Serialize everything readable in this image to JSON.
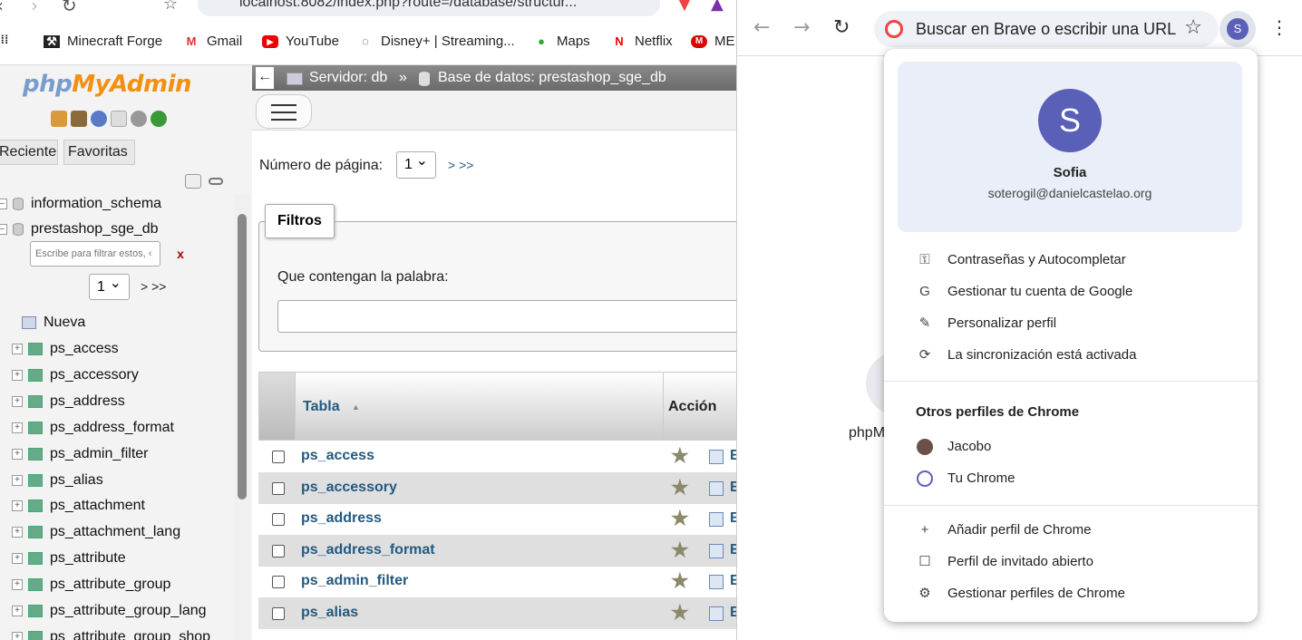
{
  "left_browser": {
    "url": "localhost:8082/index.php?route=/database/structur...",
    "bookmarks": [
      "Minecraft Forge",
      "Gmail",
      "YouTube",
      "Disney+ | Streaming...",
      "Maps",
      "Netflix",
      "ME"
    ]
  },
  "pma": {
    "logo_php": "php",
    "logo_myadmin": "MyAdmin",
    "tabs": [
      "Reciente",
      "Favoritas"
    ],
    "databases": [
      "information_schema",
      "prestashop_sge_db"
    ],
    "filter_placeholder": "Escribe para filtrar estos, ‹",
    "filter_clear": "x",
    "page_select": "1",
    "page_nav": "> >>",
    "new_label": "Nueva",
    "tables": [
      "ps_access",
      "ps_accessory",
      "ps_address",
      "ps_address_format",
      "ps_admin_filter",
      "ps_alias",
      "ps_attachment",
      "ps_attachment_lang",
      "ps_attribute",
      "ps_attribute_group",
      "ps_attribute_group_lang",
      "ps_attribute_group_shop"
    ],
    "breadcrumb": {
      "back": "←",
      "server": "Servidor: db",
      "sep": "»",
      "database": "Base de datos: prestashop_sge_db"
    },
    "page_label": "Número de página:",
    "page_value": "1",
    "page_links": "> >>",
    "filters_title": "Filtros",
    "filters_word_label": "Que contengan la palabra:",
    "col_table": "Tabla",
    "col_action": "Acción",
    "sort_arrow": "▲",
    "rows": [
      {
        "name": "ps_access",
        "action": "E"
      },
      {
        "name": "ps_accessory",
        "action": "E"
      },
      {
        "name": "ps_address",
        "action": "E"
      },
      {
        "name": "ps_address_format",
        "action": "E"
      },
      {
        "name": "ps_admin_filter",
        "action": "E"
      },
      {
        "name": "ps_alias",
        "action": "E"
      }
    ]
  },
  "right_browser": {
    "omnibox_text": "Buscar en Brave o escribir una URL",
    "avatar_letter": "S",
    "bg_label": "phpM",
    "profile": {
      "initial": "S",
      "name": "Sofia",
      "email": "soterogil@danielcastelao.org"
    },
    "menu": [
      {
        "icon": "key-icon",
        "glyph": "⚿",
        "label": "Contraseñas y Autocompletar"
      },
      {
        "icon": "google-icon",
        "glyph": "G",
        "label": "Gestionar tu cuenta de Google"
      },
      {
        "icon": "pencil-icon",
        "glyph": "✎",
        "label": "Personalizar perfil"
      },
      {
        "icon": "sync-icon",
        "glyph": "⟳",
        "label": "La sincronización está activada"
      }
    ],
    "others_heading": "Otros perfiles de Chrome",
    "others": [
      {
        "icon": "jacobo-avatar-icon",
        "label": "Jacobo"
      },
      {
        "icon": "person-circle-icon",
        "label": "Tu Chrome"
      }
    ],
    "bottom": [
      {
        "icon": "add-person-icon",
        "glyph": "+",
        "label": "Añadir perfil de Chrome"
      },
      {
        "icon": "guest-icon",
        "glyph": "☐",
        "label": "Perfil de invitado abierto"
      },
      {
        "icon": "manage-profiles-icon",
        "glyph": "⚙",
        "label": "Gestionar perfiles de Chrome"
      }
    ]
  }
}
